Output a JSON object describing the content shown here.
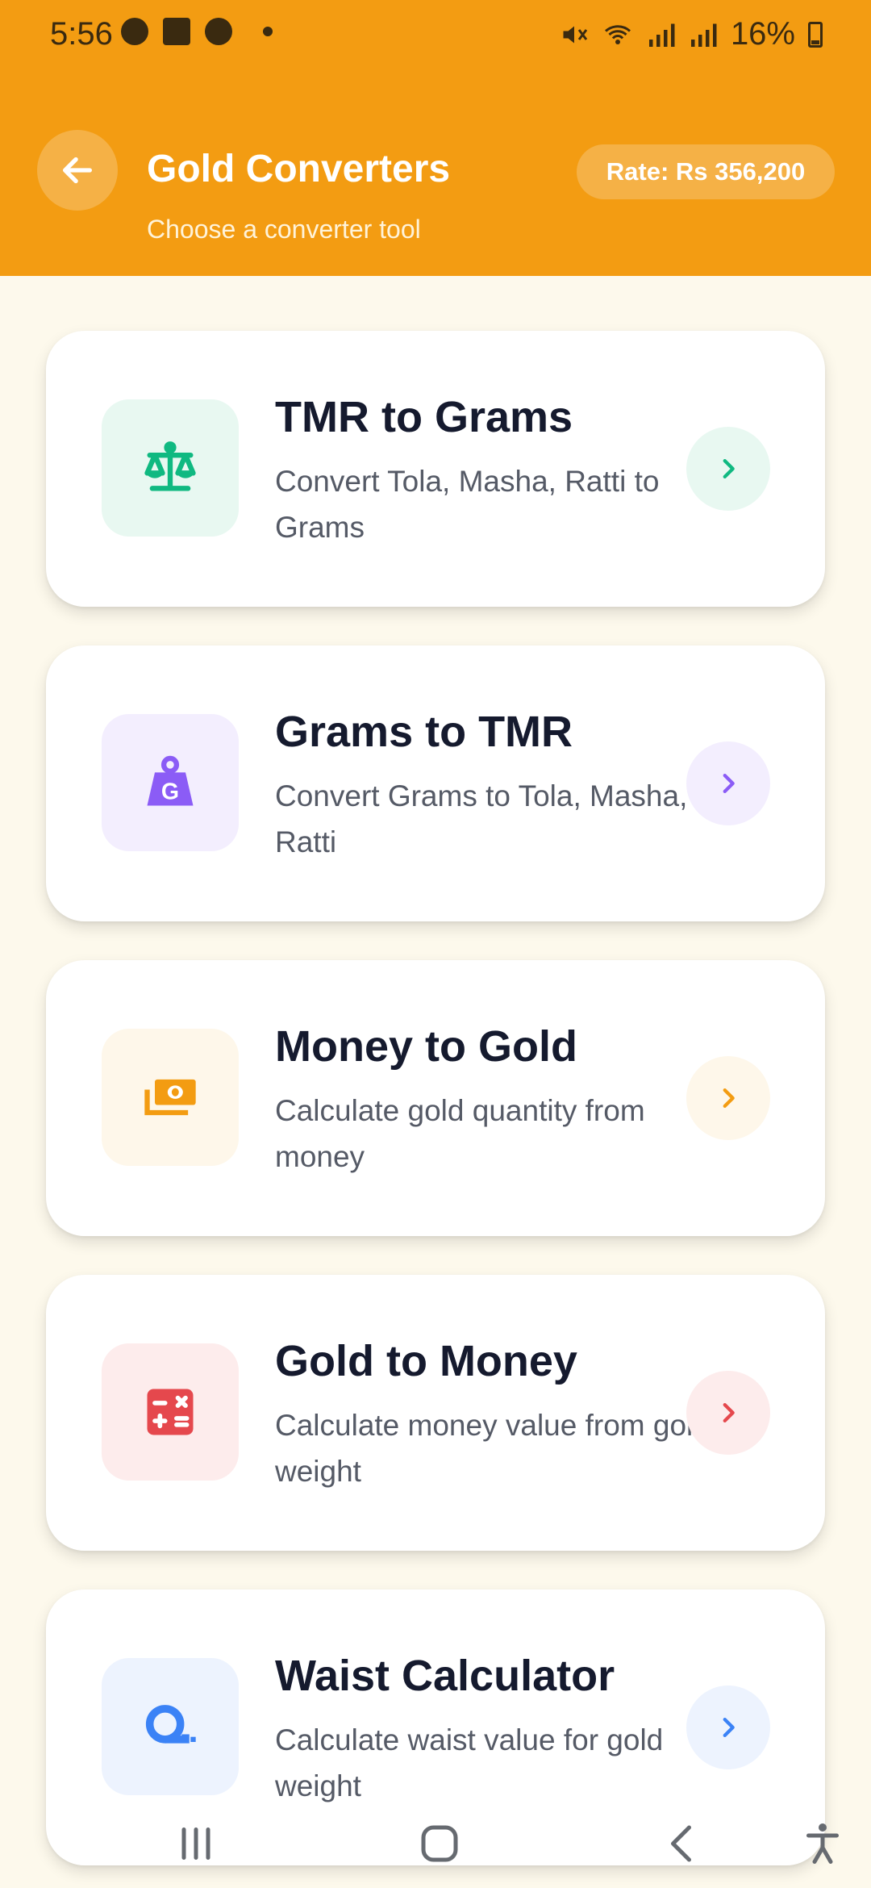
{
  "status": {
    "time": "5:56",
    "battery": "16%"
  },
  "header": {
    "title": "Gold Converters",
    "subtitle": "Choose a converter tool",
    "rate": "Rate: Rs 356,200"
  },
  "converters": [
    {
      "title": "TMR to Grams",
      "description": "Convert Tola, Masha, Ratti to Grams",
      "icon": "scale-icon",
      "color": "#10b981",
      "bg": "#e8f8f1"
    },
    {
      "title": "Grams to TMR",
      "description": "Convert Grams to Tola, Masha, Ratti",
      "icon": "weight-icon",
      "color": "#8b5cf6",
      "bg": "#f3eefe"
    },
    {
      "title": "Money to Gold",
      "description": "Calculate gold quantity from money",
      "icon": "money-icon",
      "color": "#f39c12",
      "bg": "#fef7ea"
    },
    {
      "title": "Gold to Money",
      "description": "Calculate money value from gold weight",
      "icon": "calculator-icon",
      "color": "#e5484d",
      "bg": "#fdecec"
    },
    {
      "title": "Waist Calculator",
      "description": "Calculate waist value for gold weight",
      "icon": "tape-measure-icon",
      "color": "#3b82f6",
      "bg": "#edf3fe"
    }
  ],
  "colors": {
    "header": "#f39c12",
    "background": "#fdf9ec"
  }
}
